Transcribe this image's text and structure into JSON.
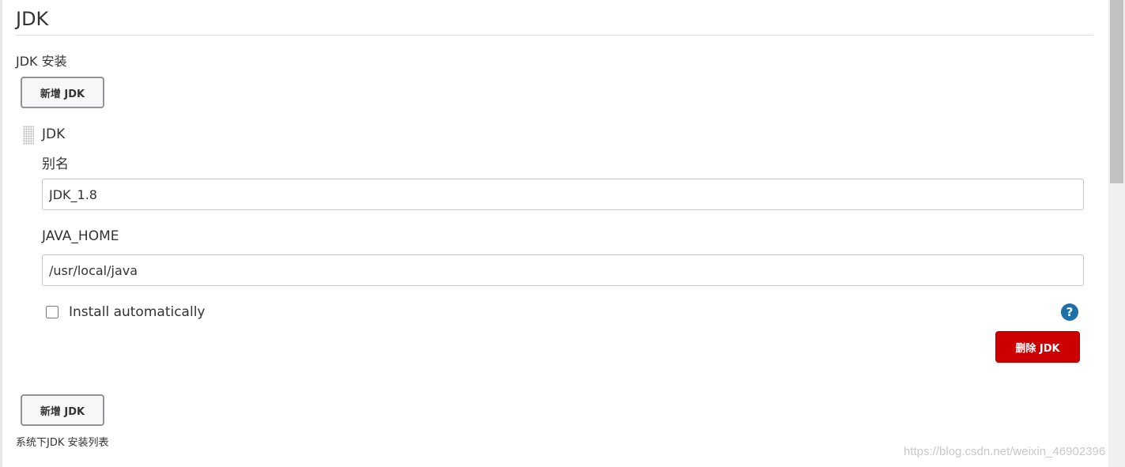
{
  "section": {
    "title": "JDK",
    "install_label": "JDK 安装"
  },
  "buttons": {
    "add_jdk": "新增 JDK",
    "delete_jdk": "删除 JDK"
  },
  "entry": {
    "title": "JDK",
    "alias_label": "别名",
    "alias_value": "JDK_1.8",
    "java_home_label": "JAVA_HOME",
    "java_home_value": "/usr/local/java",
    "install_auto_label": "Install automatically",
    "install_auto_checked": false,
    "help_icon": "question-circle-icon"
  },
  "footer": {
    "caption": "系统下JDK 安装列表",
    "watermark": "https://blog.csdn.net/weixin_46902396"
  },
  "colors": {
    "delete_button": "#cc0000",
    "help_icon": "#1f6fa8"
  }
}
